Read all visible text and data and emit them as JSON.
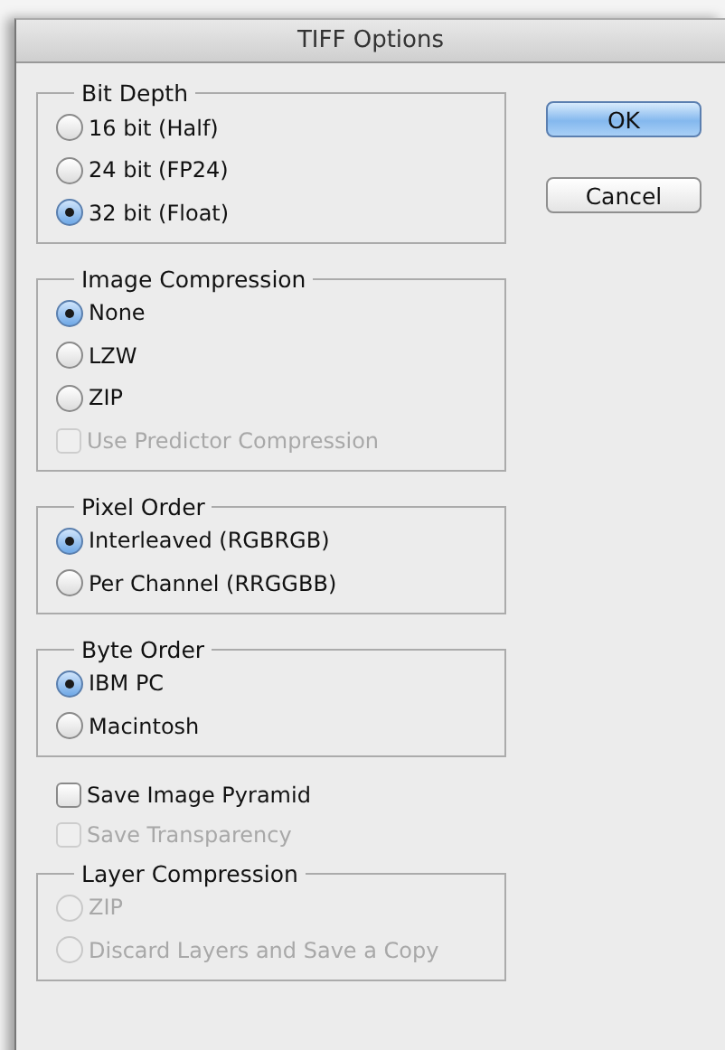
{
  "window": {
    "title": "TIFF Options"
  },
  "sections": [
    {
      "kind": "group",
      "title": "Bit Depth",
      "items": [
        {
          "kind": "radio",
          "label": "16 bit (Half)",
          "selected": false,
          "disabled": false
        },
        {
          "kind": "radio",
          "label": "24 bit (FP24)",
          "selected": false,
          "disabled": false
        },
        {
          "kind": "radio",
          "label": "32 bit (Float)",
          "selected": true,
          "disabled": false
        }
      ]
    },
    {
      "kind": "group",
      "title": "Image Compression",
      "items": [
        {
          "kind": "radio",
          "label": "None",
          "selected": true,
          "disabled": false
        },
        {
          "kind": "radio",
          "label": "LZW",
          "selected": false,
          "disabled": false
        },
        {
          "kind": "radio",
          "label": "ZIP",
          "selected": false,
          "disabled": false
        },
        {
          "kind": "checkbox",
          "label": "Use Predictor Compression",
          "checked": false,
          "disabled": true
        }
      ]
    },
    {
      "kind": "group",
      "title": "Pixel Order",
      "items": [
        {
          "kind": "radio",
          "label": "Interleaved (RGBRGB)",
          "selected": true,
          "disabled": false
        },
        {
          "kind": "radio",
          "label": "Per Channel (RRGGBB)",
          "selected": false,
          "disabled": false
        }
      ]
    },
    {
      "kind": "group",
      "title": "Byte Order",
      "items": [
        {
          "kind": "radio",
          "label": "IBM PC",
          "selected": true,
          "disabled": false
        },
        {
          "kind": "radio",
          "label": "Macintosh",
          "selected": false,
          "disabled": false
        }
      ]
    },
    {
      "kind": "checkbox",
      "label": "Save Image Pyramid",
      "checked": false,
      "disabled": false
    },
    {
      "kind": "checkbox",
      "label": "Save Transparency",
      "checked": false,
      "disabled": true
    },
    {
      "kind": "group",
      "title": "Layer Compression",
      "items": [
        {
          "kind": "radio",
          "label": "ZIP",
          "selected": false,
          "disabled": true
        },
        {
          "kind": "radio",
          "label": "Discard Layers and Save a Copy",
          "selected": false,
          "disabled": true
        }
      ]
    }
  ],
  "buttons": [
    {
      "label": "OK",
      "default": true
    },
    {
      "label": "Cancel",
      "default": false
    }
  ]
}
